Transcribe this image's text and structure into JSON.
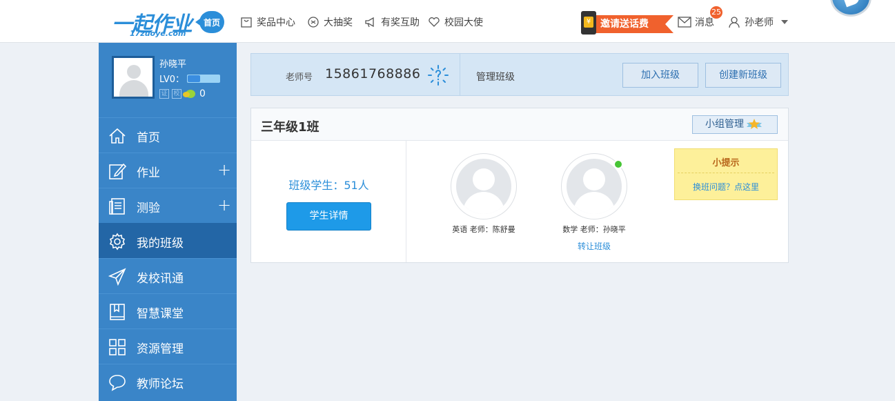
{
  "header": {
    "logo_text": "一起作业",
    "logo_sub": "17zuoye.com",
    "home_badge": "首页",
    "nav": [
      {
        "label": "奖品中心",
        "icon": "gift-bag-icon"
      },
      {
        "label": "大抽奖",
        "icon": "lottery-icon"
      },
      {
        "label": "有奖互助",
        "icon": "megaphone-icon"
      },
      {
        "label": "校园大使",
        "icon": "heart-icon"
      }
    ],
    "invite_label": "邀请送话费",
    "messages_label": "消息",
    "messages_count": "25",
    "user_label": "孙老师"
  },
  "profile": {
    "name": "孙晓平",
    "level": "LV0：",
    "badge_cert": "证",
    "badge_school": "校",
    "coins": "0"
  },
  "sidebar": {
    "items": [
      {
        "label": "首页",
        "icon": "home-icon",
        "expandable": false
      },
      {
        "label": "作业",
        "icon": "edit-icon",
        "expandable": true
      },
      {
        "label": "测验",
        "icon": "quiz-icon",
        "expandable": true
      },
      {
        "label": "我的班级",
        "icon": "gear-icon",
        "expandable": false,
        "active": true
      },
      {
        "label": "发校讯通",
        "icon": "send-icon",
        "expandable": false
      },
      {
        "label": "智慧课堂",
        "icon": "book-icon",
        "expandable": false
      },
      {
        "label": "资源管理",
        "icon": "grid-icon",
        "expandable": false
      },
      {
        "label": "教师论坛",
        "icon": "chat-icon",
        "expandable": false
      }
    ],
    "plus": "+"
  },
  "teacher_bar": {
    "label": "老师号",
    "number": "15861768886",
    "manage_label": "管理班级",
    "join_button": "加入班级",
    "create_button": "创建新班级"
  },
  "class_card": {
    "title": "三年级1班",
    "group_button": "小组管理",
    "student_count": "班级学生：51人",
    "student_button": "学生详情",
    "teachers": [
      {
        "name": "英语 老师：陈舒曼",
        "online": false,
        "transfer": ""
      },
      {
        "name": "数学 老师：孙晓平",
        "online": true,
        "transfer": "转让班级"
      }
    ],
    "tip_title": "小提示",
    "tip_link": "换班问题？点这里"
  },
  "colors": {
    "brand_blue": "#2b8ed9",
    "sidebar_bg": "#3a85c8",
    "sidebar_active": "#2366a6",
    "accent_orange": "#f0612d",
    "online_green": "#47c536",
    "tip_yellow": "#fdf09a"
  }
}
